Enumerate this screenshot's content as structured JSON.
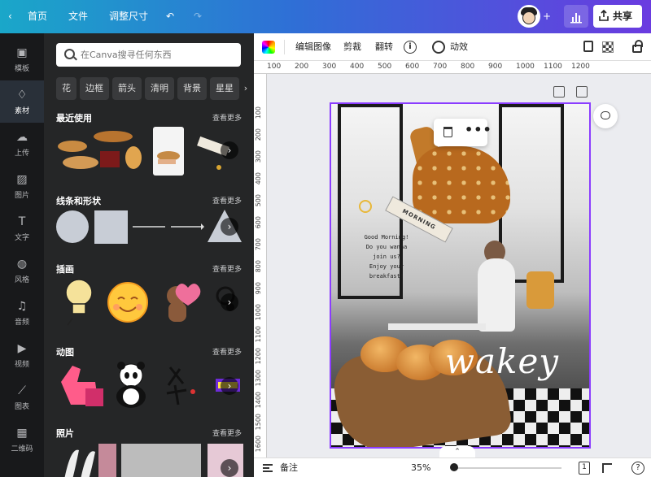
{
  "topbar": {
    "home": "首页",
    "file": "文件",
    "resize": "调整尺寸",
    "plus": "+",
    "share": "共享",
    "back_glyph": "‹",
    "undo_glyph": "↶",
    "redo_glyph": "↷"
  },
  "rail": [
    {
      "label": "模板",
      "icon": "template-icon",
      "glyph": "▣"
    },
    {
      "label": "素材",
      "icon": "elements-icon",
      "glyph": "♢"
    },
    {
      "label": "上传",
      "icon": "upload-icon",
      "glyph": "☁"
    },
    {
      "label": "图片",
      "icon": "photos-icon",
      "glyph": "▨"
    },
    {
      "label": "文字",
      "icon": "text-icon",
      "glyph": "T"
    },
    {
      "label": "风格",
      "icon": "styles-icon",
      "glyph": "◍"
    },
    {
      "label": "音频",
      "icon": "audio-icon",
      "glyph": "♫"
    },
    {
      "label": "视频",
      "icon": "video-icon",
      "glyph": "▶"
    },
    {
      "label": "图表",
      "icon": "charts-icon",
      "glyph": "⟋"
    },
    {
      "label": "二维码",
      "icon": "qr-code-icon",
      "glyph": "▦"
    }
  ],
  "search": {
    "placeholder": "在Canva搜寻任何东西"
  },
  "chips": [
    "花",
    "边框",
    "箭头",
    "清明",
    "背景",
    "星星"
  ],
  "sections": [
    {
      "title": "最近使用",
      "more": "查看更多"
    },
    {
      "title": "线条和形状",
      "more": "查看更多"
    },
    {
      "title": "插画",
      "more": "查看更多"
    },
    {
      "title": "动图",
      "more": "查看更多"
    },
    {
      "title": "照片",
      "more": "查看更多"
    }
  ],
  "editor_toolbar": {
    "edit_image": "编辑图像",
    "crop": "剪裁",
    "flip": "翻转",
    "animate": "动效"
  },
  "ruler_top": [
    "100",
    "200",
    "300",
    "400",
    "500",
    "600",
    "700",
    "800",
    "900",
    "1000",
    "1100",
    "1200"
  ],
  "ruler_left": [
    "100",
    "200",
    "300",
    "400",
    "500",
    "600",
    "700",
    "800",
    "900",
    "1000",
    "1100",
    "1200",
    "1300",
    "1400",
    "1500",
    "1600"
  ],
  "design": {
    "greeting_lines": [
      "Good Morning!",
      "Do you wanna",
      "join us?",
      "Enjoy your",
      "breakfast!"
    ],
    "sign_text": "MORNING",
    "headline": "wakey"
  },
  "bottombar": {
    "notes": "备注",
    "zoom": "35%",
    "zoom_level": 0.35,
    "page_number": "1",
    "help": "?"
  },
  "colors": {
    "selection": "#8b3dff",
    "panel_bg": "#252627",
    "rail_bg": "#18191b"
  }
}
